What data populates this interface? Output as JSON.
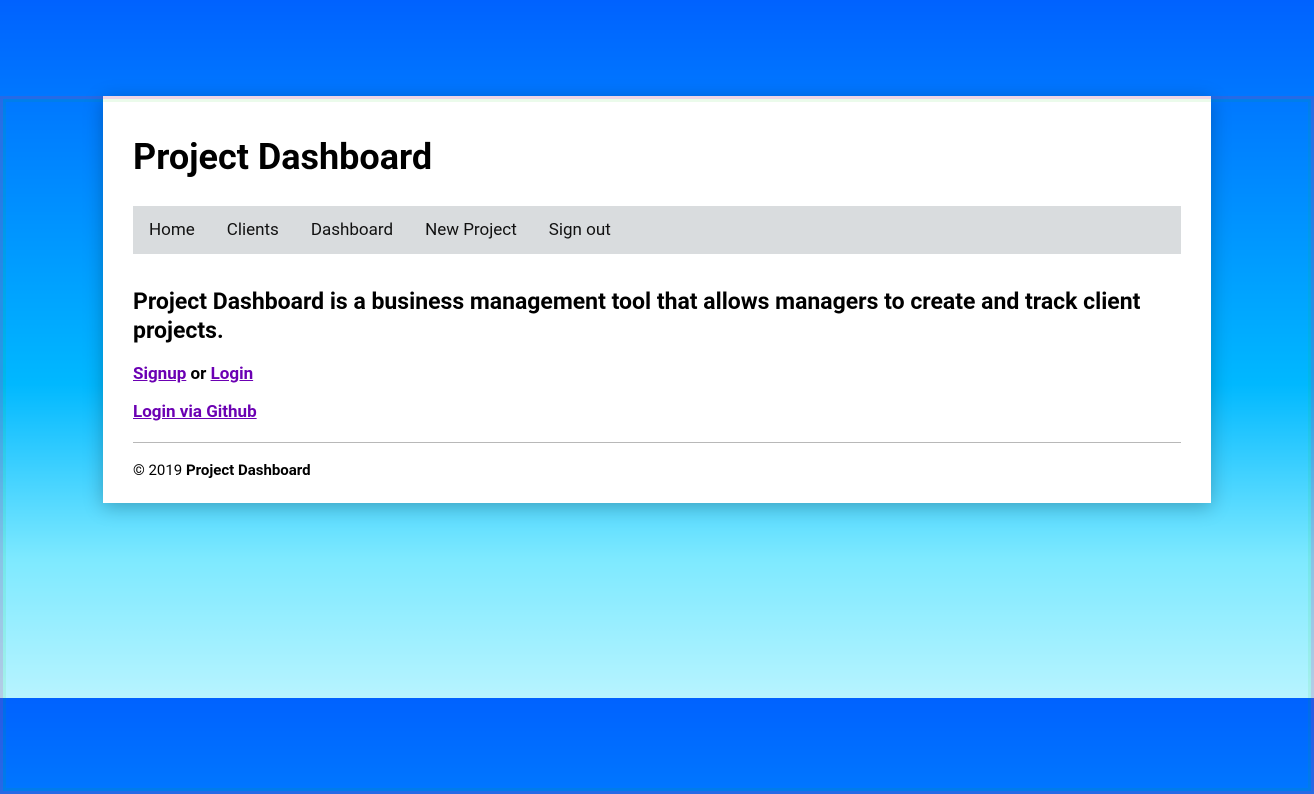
{
  "header": {
    "title": "Project Dashboard"
  },
  "nav": {
    "items": [
      {
        "label": "Home"
      },
      {
        "label": "Clients"
      },
      {
        "label": "Dashboard"
      },
      {
        "label": "New Project"
      },
      {
        "label": "Sign out"
      }
    ]
  },
  "main": {
    "lead": "Project Dashboard is a business management tool that allows managers to create and track client projects.",
    "signup_label": "Signup",
    "or_text": " or ",
    "login_label": "Login",
    "github_label": "Login via Github"
  },
  "footer": {
    "copyright_prefix": "© 2019 ",
    "brand": "Project Dashboard"
  }
}
